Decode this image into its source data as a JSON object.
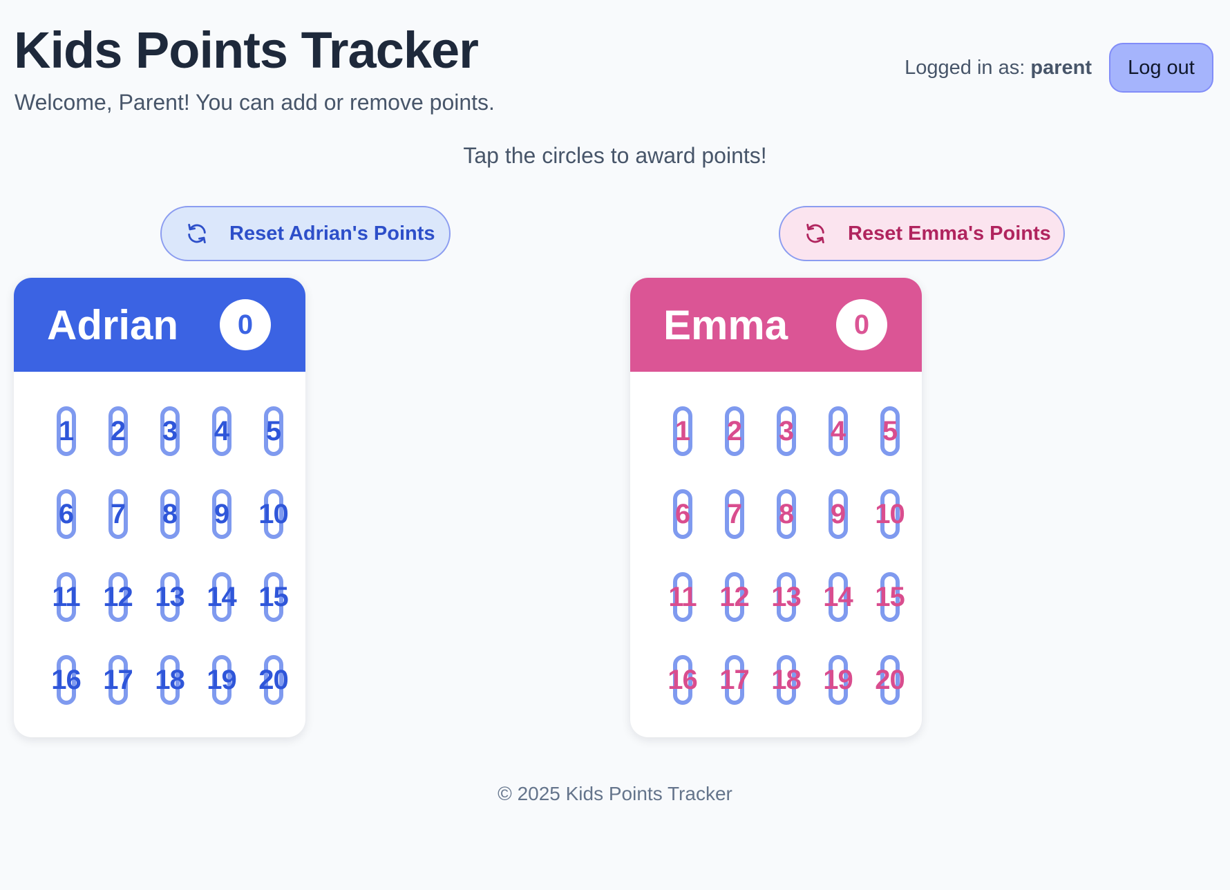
{
  "header": {
    "title": "Kids Points Tracker",
    "welcome": "Welcome, Parent! You can add or remove points.",
    "logged_in_prefix": "Logged in as:",
    "username": "parent",
    "logout_label": "Log out"
  },
  "instructions": "Tap the circles to award points!",
  "reset_buttons": {
    "adrian": {
      "label": "Reset Adrian's Points",
      "icon": "refresh-icon"
    },
    "emma": {
      "label": "Reset Emma's Points",
      "icon": "refresh-icon"
    }
  },
  "kids": [
    {
      "name": "Adrian",
      "score": "0",
      "color": "#3b63e3",
      "points": [
        "1",
        "2",
        "3",
        "4",
        "5",
        "6",
        "7",
        "8",
        "9",
        "10",
        "11",
        "12",
        "13",
        "14",
        "15",
        "16",
        "17",
        "18",
        "19",
        "20"
      ]
    },
    {
      "name": "Emma",
      "score": "0",
      "color": "#db5595",
      "points": [
        "1",
        "2",
        "3",
        "4",
        "5",
        "6",
        "7",
        "8",
        "9",
        "10",
        "11",
        "12",
        "13",
        "14",
        "15",
        "16",
        "17",
        "18",
        "19",
        "20"
      ]
    }
  ],
  "footer": "© 2025 Kids Points Tracker"
}
